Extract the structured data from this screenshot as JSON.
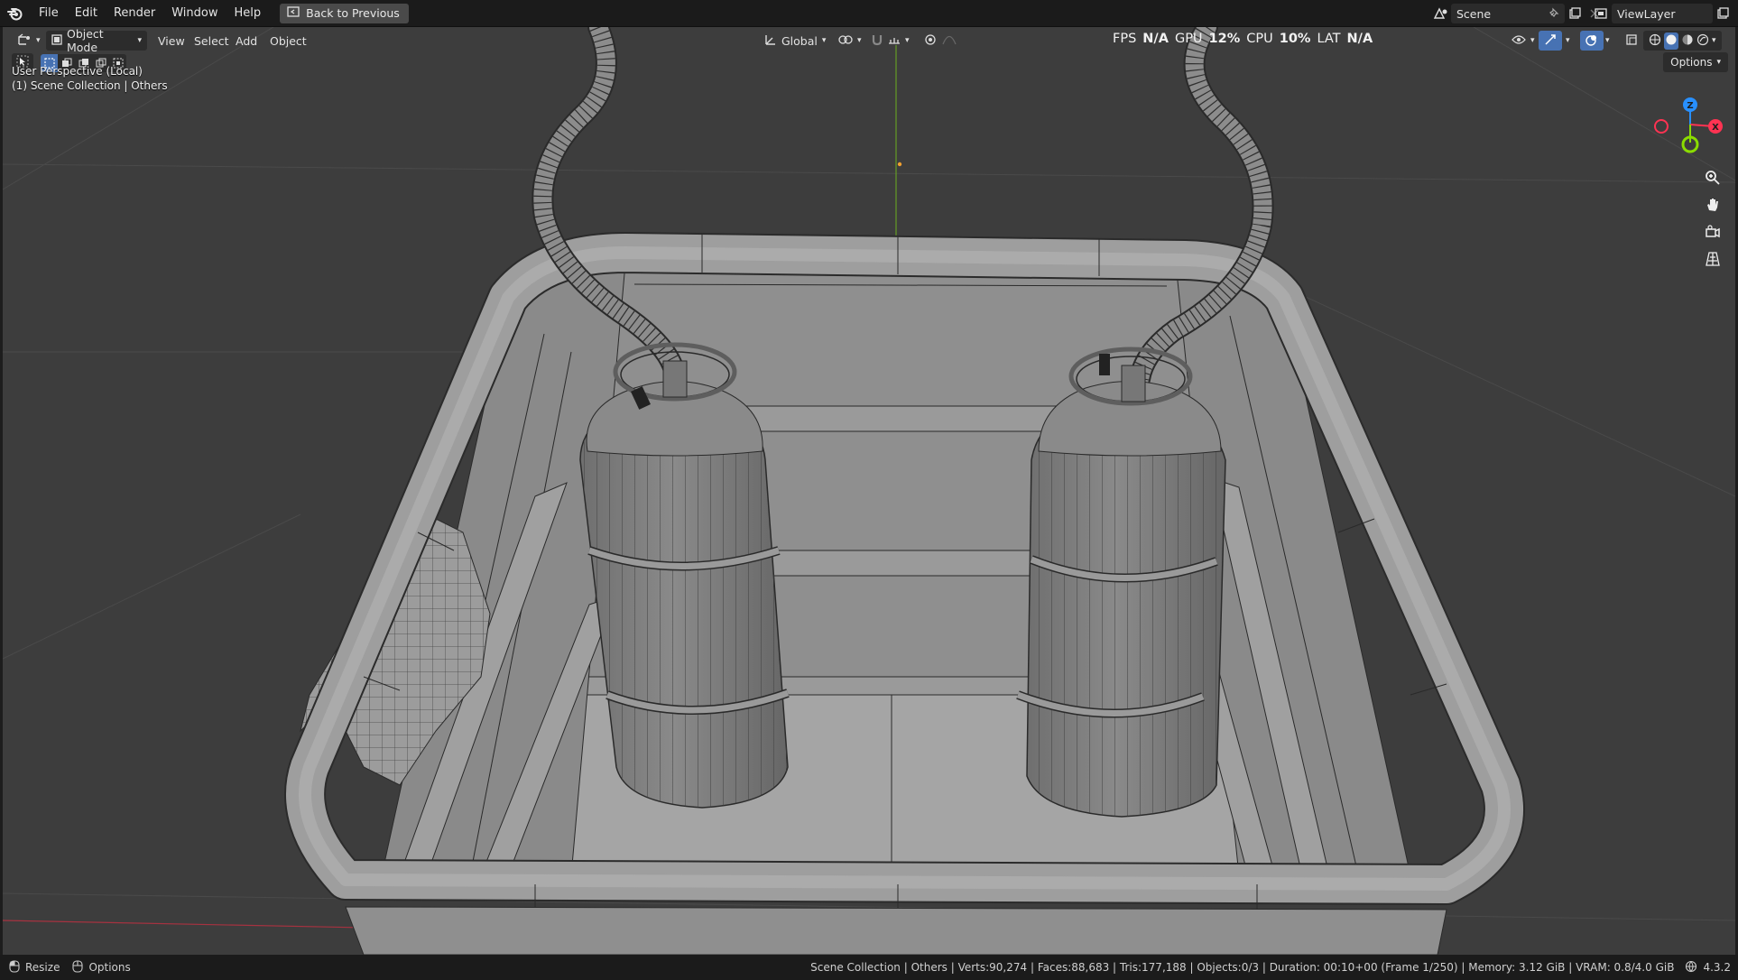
{
  "menubar": {
    "items": [
      "File",
      "Edit",
      "Render",
      "Window",
      "Help"
    ],
    "back_button": "Back to Previous",
    "scene_name": "Scene",
    "view_layer": "ViewLayer"
  },
  "viewport_header": {
    "mode": "Object Mode",
    "menus": [
      "View",
      "Select",
      "Add",
      "Object"
    ],
    "orientation": "Global",
    "options": "Options"
  },
  "stats": {
    "fps_label": "FPS",
    "fps_value": "N/A",
    "gpu_label": "GPU",
    "gpu_value": "12%",
    "cpu_label": "CPU",
    "cpu_value": "10%",
    "lat_label": "LAT",
    "lat_value": "N/A"
  },
  "overlay": {
    "view_name": "User Perspective (Local)",
    "collection": "(1) Scene Collection | Others"
  },
  "gizmo": {
    "z": "Z",
    "x": "X"
  },
  "statusbar": {
    "resize": "Resize",
    "options": "Options",
    "info": "Scene Collection | Others | Verts:90,274 | Faces:88,683 | Tris:177,188 | Objects:0/3 | Duration: 00:10+00 (Frame 1/250) | Memory: 3.12 GiB | VRAM: 0.8/4.0 GiB",
    "version": "4.3.2"
  },
  "colors": {
    "accent": "#4772b3",
    "viewport_bg": "#3d3d3d",
    "axis_x": "#ff3352",
    "axis_y": "#8bdc00",
    "axis_z": "#2890ff"
  }
}
